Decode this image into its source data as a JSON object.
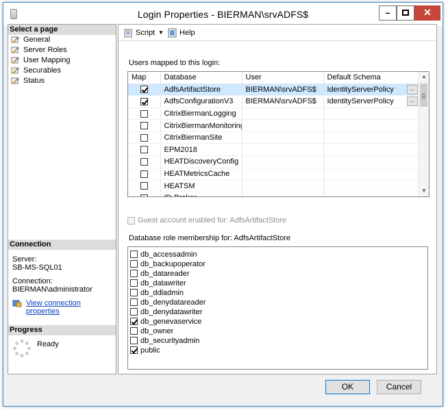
{
  "window": {
    "title": "Login Properties - BIERMAN\\srvADFS$"
  },
  "select_page": {
    "header": "Select a page",
    "items": [
      {
        "label": "General"
      },
      {
        "label": "Server Roles"
      },
      {
        "label": "User Mapping"
      },
      {
        "label": "Securables"
      },
      {
        "label": "Status"
      }
    ]
  },
  "connection": {
    "header": "Connection",
    "server_label": "Server:",
    "server_value": "SB-MS-SQL01",
    "connection_label": "Connection:",
    "connection_value": "BIERMAN\\administrator",
    "link_label": "View connection properties"
  },
  "progress": {
    "header": "Progress",
    "status": "Ready"
  },
  "toolbar": {
    "script_label": "Script",
    "help_label": "Help"
  },
  "users_mapped": {
    "label": "Users mapped to this login:",
    "columns": [
      "Map",
      "Database",
      "User",
      "Default Schema"
    ],
    "rows": [
      {
        "map": true,
        "database": "AdfsArtifactStore",
        "user": "BIERMAN\\srvADFS$",
        "schema": "IdentityServerPolicy",
        "selected": true
      },
      {
        "map": true,
        "database": "AdfsConfigurationV3",
        "user": "BIERMAN\\srvADFS$",
        "schema": "IdentityServerPolicy",
        "selected": false
      },
      {
        "map": false,
        "database": "CitrixBiermanLogging",
        "user": "",
        "schema": "",
        "selected": false
      },
      {
        "map": false,
        "database": "CitrixBiermanMonitoring",
        "user": "",
        "schema": "",
        "selected": false
      },
      {
        "map": false,
        "database": "CitrixBiermanSite",
        "user": "",
        "schema": "",
        "selected": false
      },
      {
        "map": false,
        "database": "EPM2018",
        "user": "",
        "schema": "",
        "selected": false
      },
      {
        "map": false,
        "database": "HEATDiscoveryConfig",
        "user": "",
        "schema": "",
        "selected": false
      },
      {
        "map": false,
        "database": "HEATMetricsCache",
        "user": "",
        "schema": "",
        "selected": false
      },
      {
        "map": false,
        "database": "HEATSM",
        "user": "",
        "schema": "",
        "selected": false
      },
      {
        "map": false,
        "database": "ID-Broker",
        "user": "",
        "schema": "",
        "selected": false
      }
    ]
  },
  "guest": {
    "label": "Guest account enabled for: AdfsArtifactStore",
    "checked": false
  },
  "roles": {
    "label": "Database role membership for: AdfsArtifactStore",
    "items": [
      {
        "name": "db_accessadmin",
        "checked": false
      },
      {
        "name": "db_backupoperator",
        "checked": false
      },
      {
        "name": "db_datareader",
        "checked": false
      },
      {
        "name": "db_datawriter",
        "checked": false
      },
      {
        "name": "db_ddladmin",
        "checked": false
      },
      {
        "name": "db_denydatareader",
        "checked": false
      },
      {
        "name": "db_denydatawriter",
        "checked": false
      },
      {
        "name": "db_genevaservice",
        "checked": true
      },
      {
        "name": "db_owner",
        "checked": false
      },
      {
        "name": "db_securityadmin",
        "checked": false
      },
      {
        "name": "public",
        "checked": true
      }
    ]
  },
  "buttons": {
    "ok": "OK",
    "cancel": "Cancel"
  }
}
